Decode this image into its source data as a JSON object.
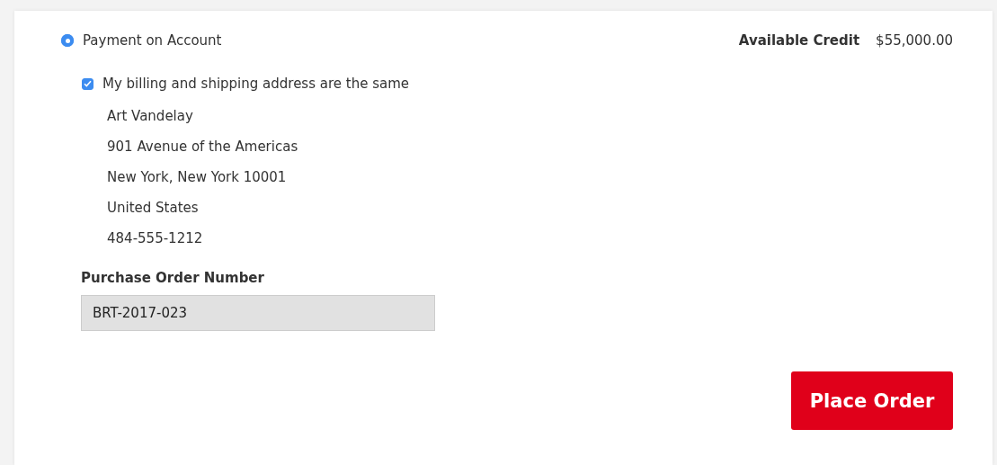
{
  "payment_method": {
    "label": "Payment on Account",
    "selected": true
  },
  "credit": {
    "label": "Available Credit",
    "value": "$55,000.00"
  },
  "same_address": {
    "label": "My billing and shipping address are the same",
    "checked": true
  },
  "address_lines": [
    "Art Vandelay",
    "901 Avenue of the Americas",
    "New York, New York 10001",
    "United States",
    "484-555-1212"
  ],
  "po_field": {
    "label": "Purchase Order Number",
    "value": "BRT-2017-023"
  },
  "buttons": [
    {
      "label": "Place Order"
    }
  ]
}
